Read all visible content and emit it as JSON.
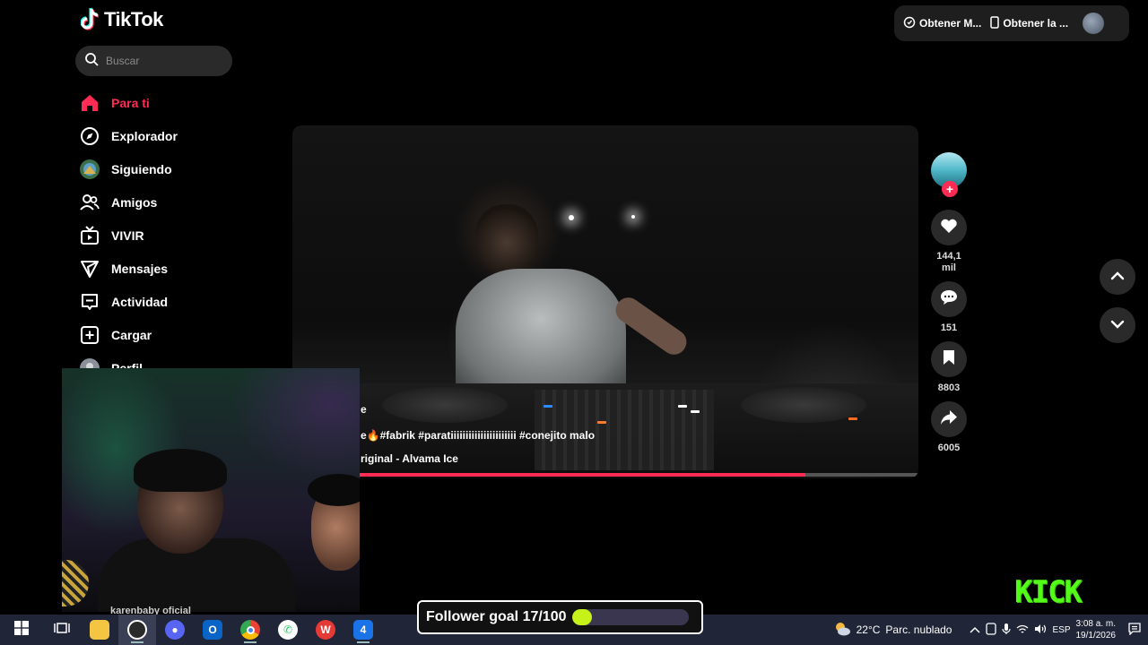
{
  "app": {
    "brand": "TikTok",
    "accent_color": "#fe2c55",
    "search": {
      "placeholder": "Buscar",
      "icon": "search-icon"
    },
    "top_bar": {
      "link1_label": "Obtener M...",
      "link1_icon": "coin-icon",
      "link2_label": "Obtener la ...",
      "link2_icon": "phone-icon"
    },
    "nav": [
      {
        "label": "Para ti",
        "icon": "home-icon",
        "active": true
      },
      {
        "label": "Explorador",
        "icon": "compass-icon"
      },
      {
        "label": "Siguiendo",
        "icon": "avatar-icon"
      },
      {
        "label": "Amigos",
        "icon": "friends-icon"
      },
      {
        "label": "VIVIR",
        "icon": "live-tv-icon"
      },
      {
        "label": "Mensajes",
        "icon": "send-icon"
      },
      {
        "label": "Actividad",
        "icon": "inbox-icon"
      },
      {
        "label": "Cargar",
        "icon": "plus-square-icon"
      },
      {
        "label": "Perfil",
        "icon": "profile-avatar-icon"
      }
    ]
  },
  "video": {
    "caption_line1": "e",
    "caption_line2": "e🔥#fabrik #paratiiiiiiiiiiiiiiiiiiiiii #conejito malo",
    "caption_line3": "riginal - Alvama Ice",
    "progress": 0.82
  },
  "actions": {
    "likes": "144,1",
    "likes_unit": "mil",
    "comments": "151",
    "saves": "8803",
    "shares": "6005"
  },
  "overlay": {
    "under_cam_text": "karenbaby oficial",
    "kick_logo": "KICK",
    "kick_color": "#53fc18",
    "follower_goal_label": "Follower goal 17/100",
    "follower_goal_current": 17,
    "follower_goal_target": 100
  },
  "taskbar": {
    "apps": [
      "windows-start-icon",
      "task-view-icon",
      "file-explorer-icon",
      "obs-icon",
      "discord-icon",
      "outlook-icon",
      "chrome-icon",
      "whatsapp-icon",
      "wps-icon",
      "outlook-badge-icon",
      "tiktok-icon",
      "app-icon"
    ],
    "weather_temp": "22°C",
    "weather_desc": "Parc. nublado",
    "language": "ESP",
    "time": "3:08 a. m.",
    "date": "19/1/2026"
  }
}
